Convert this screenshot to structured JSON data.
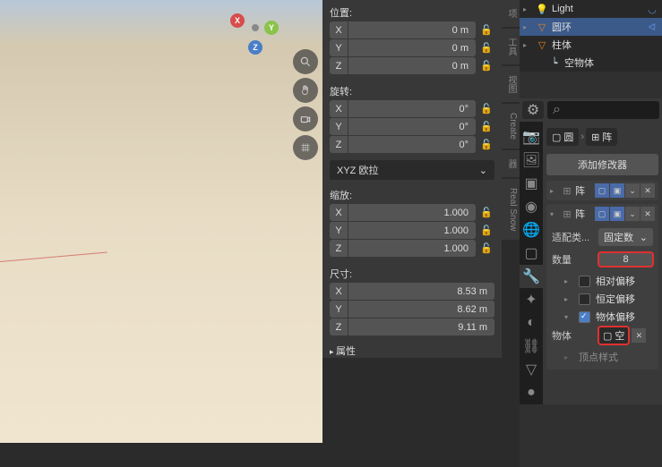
{
  "viewport": {
    "gizmo": {
      "x": "X",
      "y": "Y",
      "z": "Z"
    }
  },
  "npanel": {
    "tabs": [
      "项",
      "工具",
      "视图",
      "Create",
      "器",
      "Real Snow"
    ],
    "transform": {
      "location_label": "位置:",
      "location": {
        "x": "0 m",
        "y": "0 m",
        "z": "0 m"
      },
      "rotation_label": "旋转:",
      "rotation": {
        "x": "0°",
        "y": "0°",
        "z": "0°"
      },
      "rotation_mode": "XYZ 欧拉",
      "scale_label": "缩放:",
      "scale": {
        "x": "1.000",
        "y": "1.000",
        "z": "1.000"
      },
      "dimensions_label": "尺寸:",
      "dimensions": {
        "x": "8.53 m",
        "y": "8.62 m",
        "z": "9.11 m"
      },
      "axis": {
        "x": "X",
        "y": "Y",
        "z": "Z"
      },
      "properties_label": "属性"
    }
  },
  "outliner": {
    "items": [
      {
        "name": "Light",
        "type": "light"
      },
      {
        "name": "圆环",
        "type": "mesh",
        "selected": true
      },
      {
        "name": "柱体",
        "type": "mesh"
      },
      {
        "name": "空物体",
        "type": "empty"
      }
    ]
  },
  "properties": {
    "breadcrumb": {
      "obj": "圆",
      "mod": "阵"
    },
    "add_modifier": "添加修改器",
    "modifiers": [
      {
        "name": "阵",
        "collapsed": true
      },
      {
        "name": "阵",
        "collapsed": false,
        "fit_type_label": "适配类...",
        "fit_type_value": "固定数",
        "count_label": "数量",
        "count_value": "8",
        "relative_offset": "相对偏移",
        "constant_offset": "恒定偏移",
        "object_offset": "物体偏移",
        "object_label": "物体",
        "object_value": "空",
        "vertex_label": "顶点样式"
      }
    ]
  }
}
